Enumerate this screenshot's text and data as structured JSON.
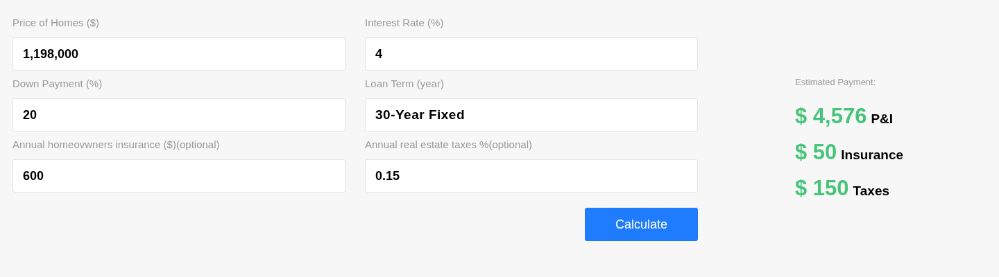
{
  "form": {
    "fields": [
      {
        "label": "Price of Homes ($)",
        "value": "1,198,000",
        "kind": "text"
      },
      {
        "label": "Interest Rate (%)",
        "value": "4",
        "kind": "text"
      },
      {
        "label": "Down Payment (%)",
        "value": "20",
        "kind": "text"
      },
      {
        "label": "Loan Term (year)",
        "value": "30-Year Fixed",
        "kind": "select"
      },
      {
        "label": "Annual homeovwners insurance ($)(optional)",
        "value": "600",
        "kind": "text"
      },
      {
        "label": "Annual real estate taxes %(optional)",
        "value": "0.15",
        "kind": "text"
      }
    ],
    "submit_button": "Calculate"
  },
  "results": {
    "title": "Estimated Payment:",
    "items": [
      {
        "amount": "$ 4,576",
        "label": "P&I"
      },
      {
        "amount": "$ 50",
        "label": "Insurance"
      },
      {
        "amount": "$ 150",
        "label": "Taxes"
      }
    ]
  }
}
